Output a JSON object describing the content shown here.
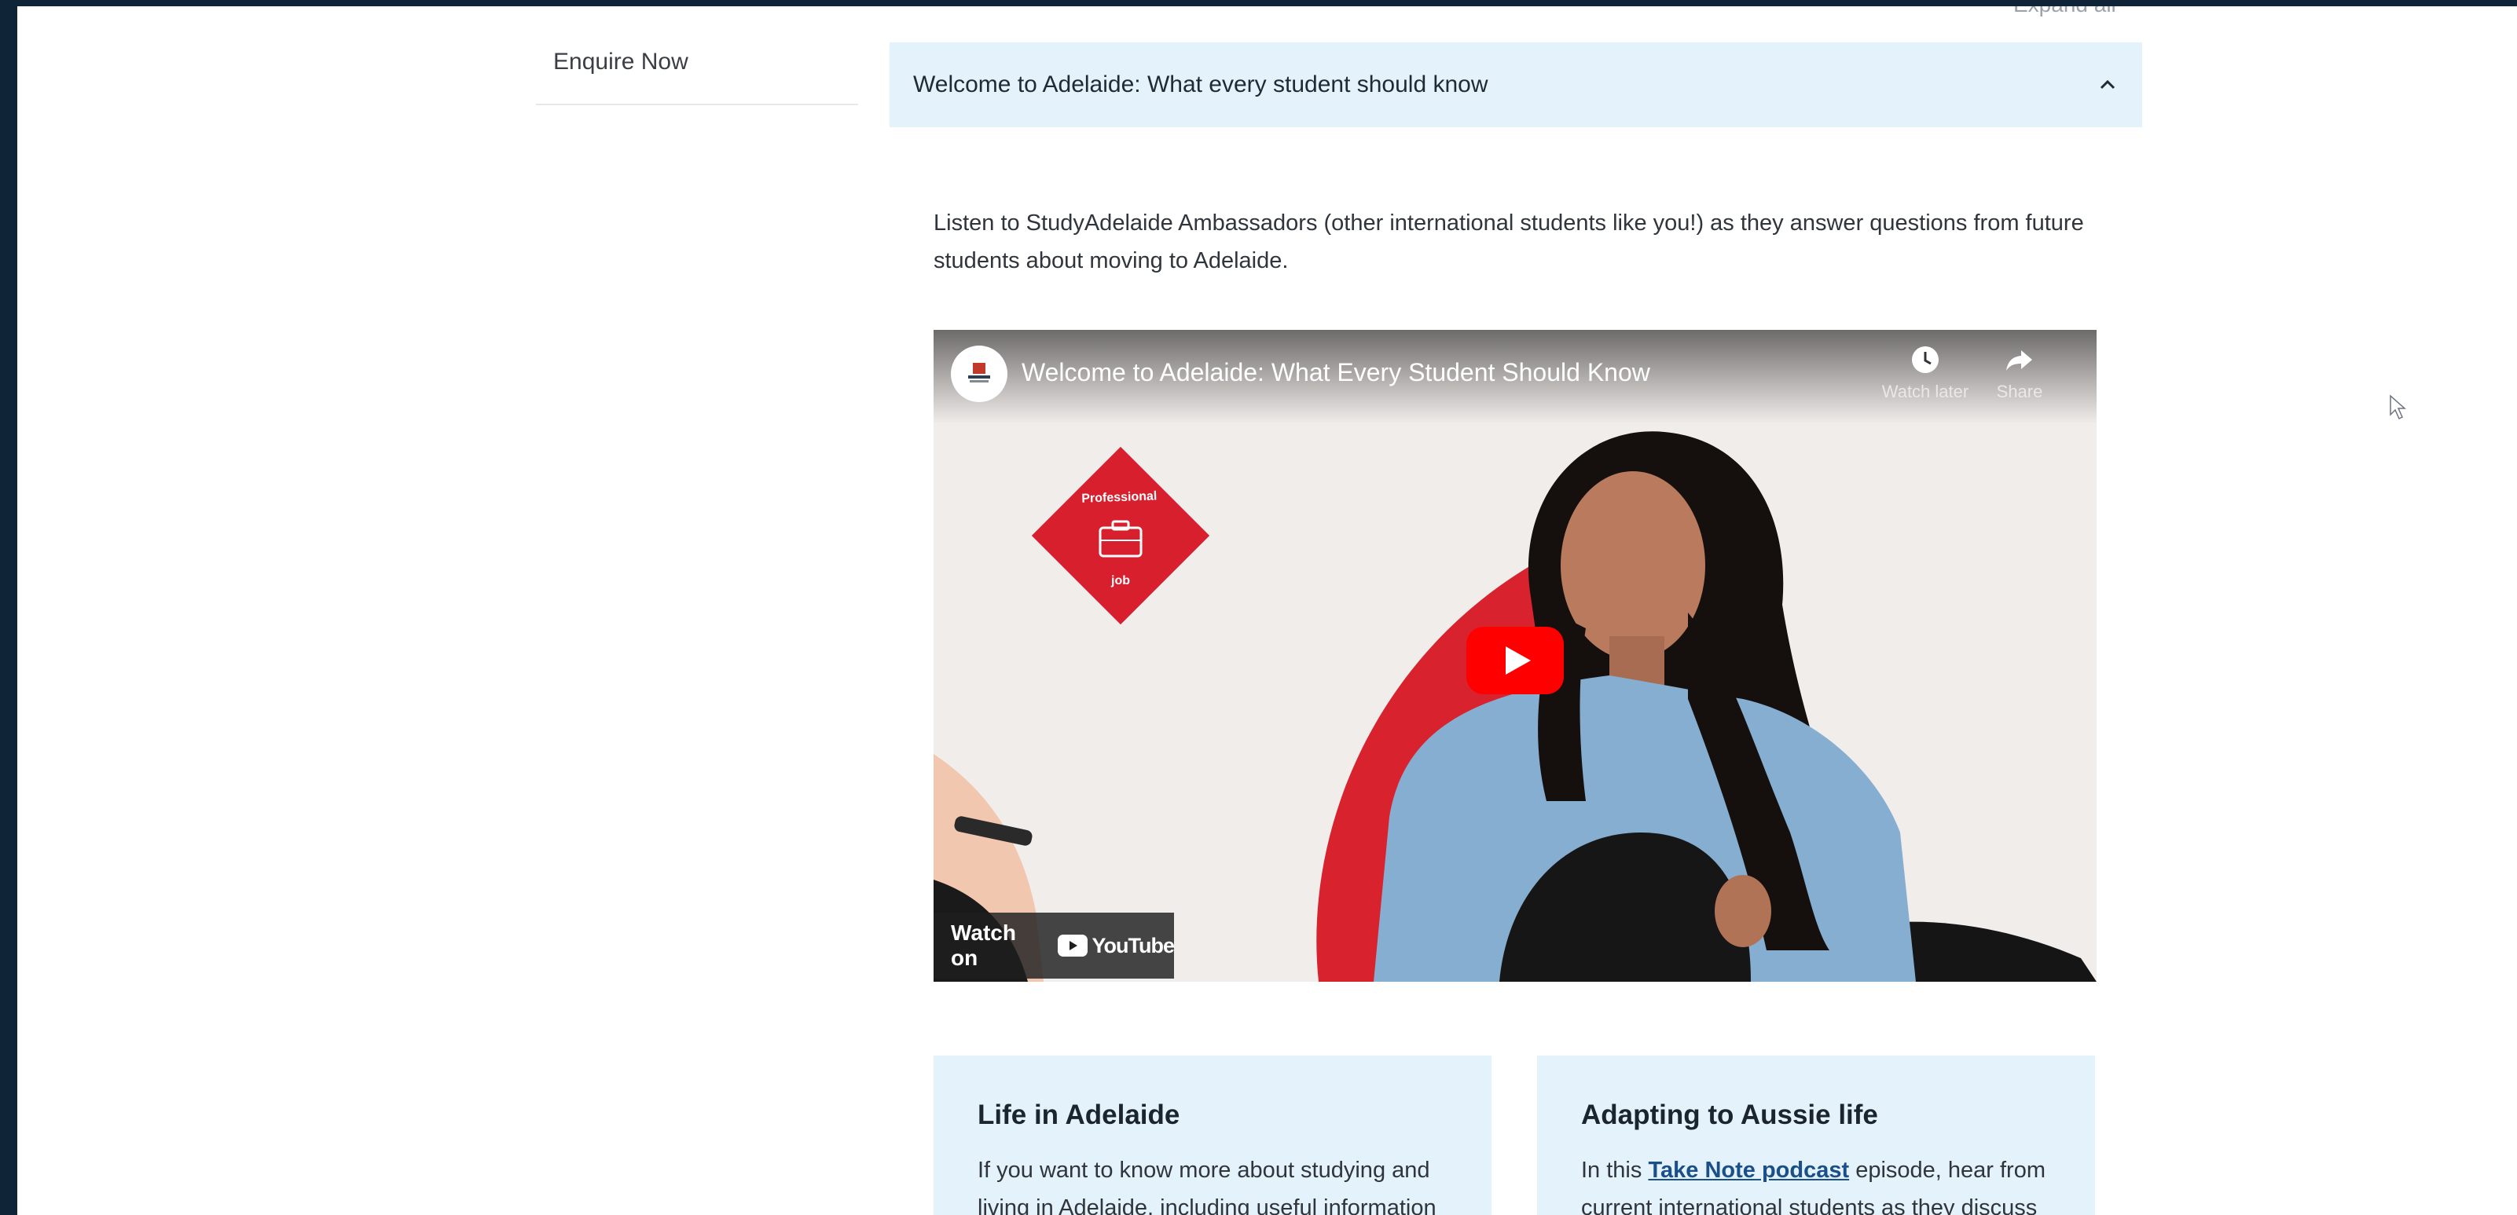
{
  "sidebar": {
    "enquire_label": "Enquire Now"
  },
  "header": {
    "expand_all_label": "Expand all"
  },
  "accordion": {
    "title": "Welcome to Adelaide: What every student should know",
    "intro": "Listen to StudyAdelaide Ambassadors (other international students like you!) as they answer questions from future students about moving to Adelaide."
  },
  "video": {
    "title": "Welcome to Adelaide: What Every Student Should Know",
    "watch_later_label": "Watch later",
    "share_label": "Share",
    "watch_on_label": "Watch on",
    "youtube_label": "YouTube",
    "badge_top_text": "Professional",
    "badge_bottom_text": "job"
  },
  "cards": [
    {
      "title": "Life in Adelaide",
      "text": "If you want to know more about studying and living in Adelaide, including useful information"
    },
    {
      "title": "Adapting to Aussie life",
      "text_before": "In this ",
      "link": "Take Note podcast",
      "text_after": " episode, hear from current international students as they discuss"
    }
  ],
  "colors": {
    "accordion_bg": "#e4f2fb",
    "link": "#1b4f8a",
    "youtube_red": "#ff0000",
    "badge_red": "#d71f2e",
    "frame_bg": "#0f2436"
  }
}
